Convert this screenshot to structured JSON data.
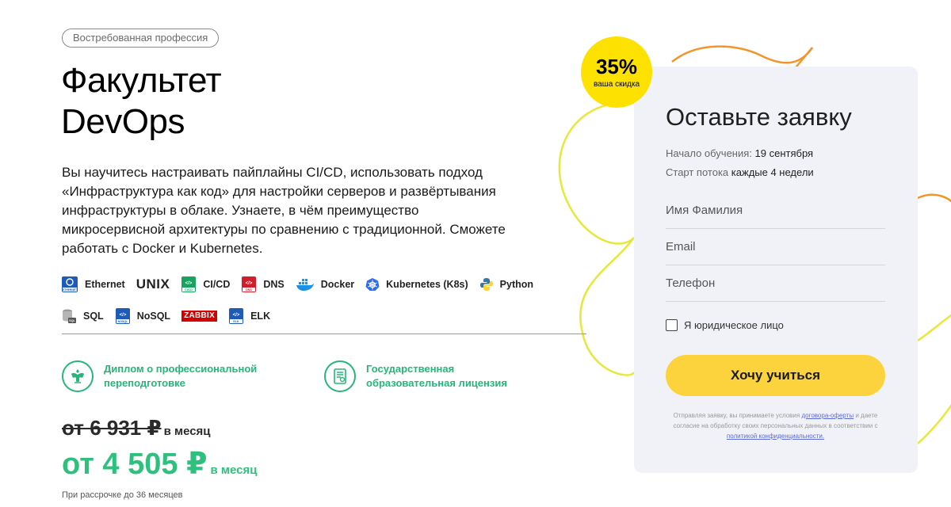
{
  "badge": "Востребованная профессия",
  "title": {
    "line1": "Факультет",
    "line2": "DevOps"
  },
  "description": "Вы научитесь настраивать пайплайны CI/CD, использовать подход «Инфраструктура как код» для настройки серверов и развёртывания инфраструктуры в облаке. Узнаете, в чём преимущество микросервисной архитектуры по сравнению с традиционной. Сможете работать с Docker и Kubernetes.",
  "technologies": [
    {
      "label": "Ethernet",
      "icon": "ethernet-icon",
      "icon_caption": "ETHERNET"
    },
    {
      "label": "UNIX",
      "icon": "unix-logo"
    },
    {
      "label": "CI/CD",
      "icon": "cicd-icon",
      "icon_caption": "CI/CD"
    },
    {
      "label": "DNS",
      "icon": "dns-icon",
      "icon_caption": "DNS"
    },
    {
      "label": "Docker",
      "icon": "docker-icon"
    },
    {
      "label": "Kubernetes (K8s)",
      "icon": "kubernetes-icon"
    },
    {
      "label": "Python",
      "icon": "python-icon"
    },
    {
      "label": "SQL",
      "icon": "database-icon",
      "icon_caption": "SQL"
    },
    {
      "label": "NoSQL",
      "icon": "nosql-icon",
      "icon_caption": "NOSQL"
    },
    {
      "label": "ZABBIX",
      "icon": "zabbix-logo"
    },
    {
      "label": "ELK",
      "icon": "elk-icon",
      "icon_caption": "ELK"
    }
  ],
  "features": [
    {
      "text": "Диплом о профессиональной переподготовке",
      "icon": "emblem-icon"
    },
    {
      "text": "Государственная образовательная лицензия",
      "icon": "license-icon"
    }
  ],
  "pricing": {
    "old_price": "от 6 931 ₽",
    "old_period": "в месяц",
    "new_price": "от 4 505 ₽",
    "new_period": "в месяц",
    "installment": "При рассрочке до 36 месяцев"
  },
  "discount": {
    "percent": "35%",
    "label": "ваша скидка"
  },
  "form": {
    "title": "Оставьте заявку",
    "start_label": "Начало обучения:",
    "start_value": "19 сентября",
    "stream_label": "Старт потока",
    "stream_value": "каждые 4 недели",
    "name_placeholder": "Имя Фамилия",
    "email_placeholder": "Email",
    "phone_placeholder": "Телефон",
    "legal_entity_label": "Я юридическое лицо",
    "submit_label": "Хочу учиться",
    "legal_text_1": "Отправляя заявку, вы принимаете условия",
    "legal_link_1": "договора-оферты",
    "legal_text_2": "и даете согласие на обработку своих персональных данных в соответствии с",
    "legal_link_2": "политикой конфиденциальности."
  },
  "colors": {
    "accent_green": "#2fc07e",
    "discount_yellow": "#fde100",
    "button_yellow": "#fdd33d",
    "form_bg": "#f1f2f7"
  }
}
